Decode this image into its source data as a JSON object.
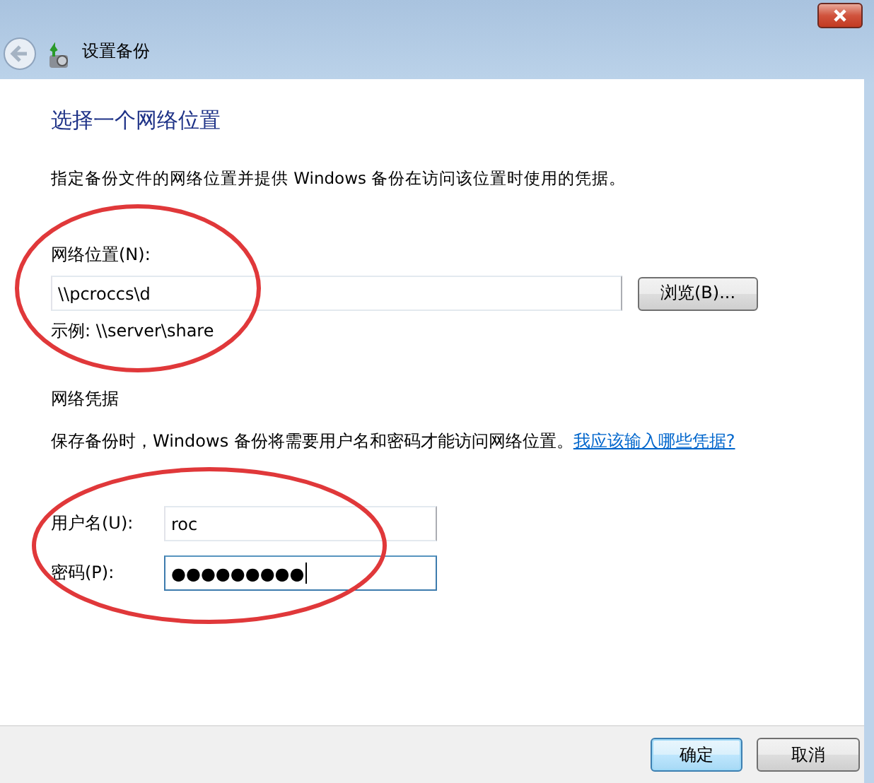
{
  "window": {
    "title": "设置备份"
  },
  "heading": "选择一个网络位置",
  "description": "指定备份文件的网络位置并提供 Windows 备份在访问该位置时使用的凭据。",
  "network_location": {
    "label": "网络位置(N):",
    "value": "\\\\pcroccs\\d",
    "browse_button": "浏览(B)...",
    "example": "示例: \\\\server\\share",
    "circled": true
  },
  "credentials": {
    "title": "网络凭据",
    "text": "保存备份时，Windows 备份将需要用户名和密码才能访问网络位置。",
    "link": "我应该输入哪些凭据?",
    "circled": true,
    "fields": [
      {
        "label": "用户名(U):",
        "value": "roc",
        "focused": false
      },
      {
        "label": "密码(P):",
        "value": "●●●●●●●●●",
        "focused": true
      }
    ]
  },
  "buttons": [
    {
      "label": "确定",
      "default": true
    },
    {
      "label": "取消",
      "default": false
    }
  ]
}
